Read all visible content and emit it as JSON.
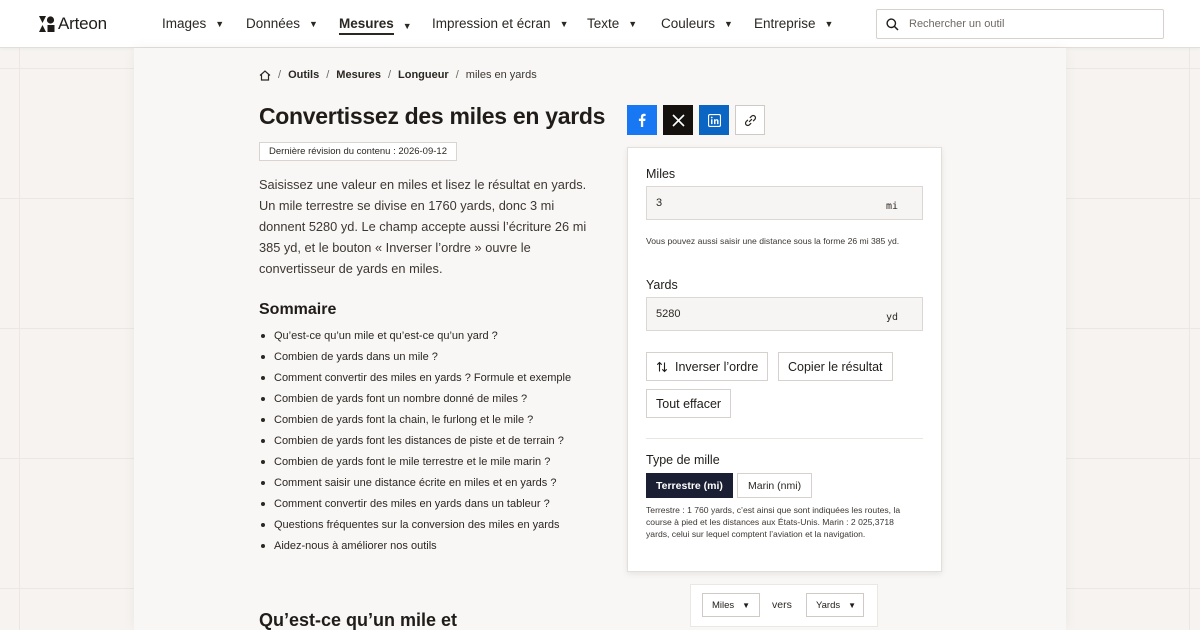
{
  "brand": {
    "name": "Arteon"
  },
  "nav": {
    "items": [
      {
        "label": "Images"
      },
      {
        "label": "Données"
      },
      {
        "label": "Mesures"
      },
      {
        "label": "Impression et écran"
      },
      {
        "label": "Texte"
      },
      {
        "label": "Couleurs"
      },
      {
        "label": "Entreprise"
      }
    ],
    "active": "Mesures",
    "search_placeholder": "Rechercher un outil"
  },
  "breadcrumb": {
    "items": [
      "Outils",
      "Mesures",
      "Longueur"
    ],
    "current": "miles en yards"
  },
  "page": {
    "title": "Convertissez des miles en yards",
    "revision": "Dernière révision du contenu : 2026-09-12",
    "intro": "Saisissez une valeur en miles et lisez le résultat en yards. Un mile terrestre se divise en 1760 yards, donc 3 mi donnent 5280 yd. Le champ accepte aussi l’écriture 26 mi 385 yd, et le bouton « Inverser l’ordre » ouvre le convertisseur de yards en miles.",
    "summary_title": "Sommaire",
    "toc": [
      "Qu’est-ce qu’un mile et qu’est-ce qu’un yard ?",
      "Combien de yards dans un mile ?",
      "Comment convertir des miles en yards ? Formule et exemple",
      "Combien de yards font un nombre donné de miles ?",
      "Combien de yards font la chain, le furlong et le mile ?",
      "Combien de yards font les distances de piste et de terrain ?",
      "Combien de yards font le mile terrestre et le mile marin ?",
      "Comment saisir une distance écrite en miles et en yards ?",
      "Comment convertir des miles en yards dans un tableur ?",
      "Questions fréquentes sur la conversion des miles en yards",
      "Aidez-nous à améliorer nos outils"
    ],
    "next_heading": "Qu’est-ce qu’un mile et"
  },
  "share": {
    "icons": [
      "facebook-icon",
      "x-icon",
      "linkedin-icon",
      "link-icon"
    ]
  },
  "converter": {
    "miles_label": "Miles",
    "miles_value": "3",
    "miles_unit": "mi",
    "miles_hint": "Vous pouvez aussi saisir une distance sous la forme 26 mi 385 yd.",
    "yards_label": "Yards",
    "yards_value": "5280",
    "yards_unit": "yd",
    "swap_label": "Inverser l’ordre",
    "copy_label": "Copier le résultat",
    "clear_label": "Tout effacer",
    "mile_type_label": "Type de mille",
    "mile_type_options": [
      "Terrestre (mi)",
      "Marin (nmi)"
    ],
    "mile_type_selected": "Terrestre (mi)",
    "mile_type_note": "Terrestre : 1 760 yards, c’est ainsi que sont indiquées les routes, la course à pied et les distances aux États-Unis. Marin : 2 025,3718 yards, celui sur lequel comptent l’aviation et la navigation."
  },
  "unit_switcher": {
    "from": "Miles",
    "connector": "vers",
    "to": "Yards"
  },
  "colors": {
    "accent_dark": "#1a1f33",
    "facebook": "#1877f2",
    "x": "#14110f",
    "linkedin": "#0a66c2"
  }
}
